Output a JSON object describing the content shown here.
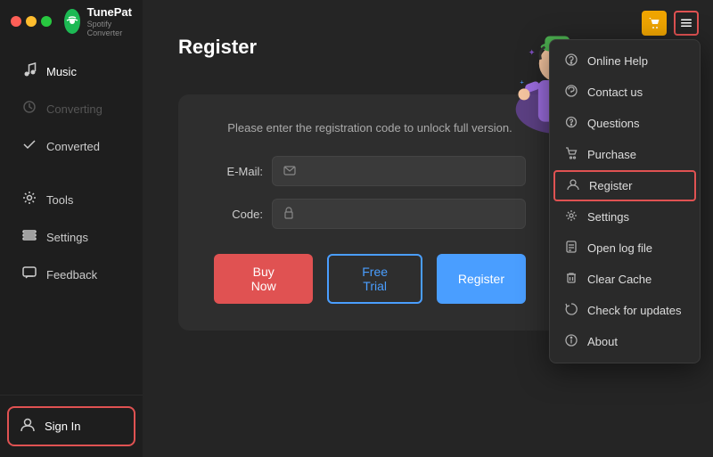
{
  "app": {
    "name": "TunePat",
    "subtitle": "Spotify Converter"
  },
  "traffic_lights": {
    "red": "close",
    "yellow": "minimize",
    "green": "maximize"
  },
  "sidebar": {
    "items": [
      {
        "id": "music",
        "label": "Music",
        "icon": "♪",
        "active": true,
        "disabled": false
      },
      {
        "id": "converting",
        "label": "Converting",
        "icon": "⟳",
        "active": false,
        "disabled": true
      },
      {
        "id": "converted",
        "label": "Converted",
        "icon": "✓",
        "active": false,
        "disabled": false
      }
    ],
    "tools_section": [
      {
        "id": "tools",
        "label": "Tools",
        "icon": "⚙"
      },
      {
        "id": "settings",
        "label": "Settings",
        "icon": "≡"
      },
      {
        "id": "feedback",
        "label": "Feedback",
        "icon": "✉"
      }
    ],
    "sign_in_label": "Sign In"
  },
  "topbar": {
    "cart_icon": "🛒",
    "menu_icon": "☰"
  },
  "register_page": {
    "title": "Register",
    "description": "Please enter the registration code to unlock full version.",
    "email_label": "E-Mail:",
    "email_placeholder": "",
    "code_label": "Code:",
    "code_placeholder": "",
    "btn_buy_now": "Buy Now",
    "btn_free_trial": "Free Trial",
    "btn_register": "Register"
  },
  "dropdown": {
    "items": [
      {
        "id": "online-help",
        "label": "Online Help",
        "icon": "❓"
      },
      {
        "id": "contact-us",
        "label": "Contact us",
        "icon": "💬"
      },
      {
        "id": "questions",
        "label": "Questions",
        "icon": "❔"
      },
      {
        "id": "purchase",
        "label": "Purchase",
        "icon": "🛒"
      },
      {
        "id": "register",
        "label": "Register",
        "icon": "👤",
        "active": true
      },
      {
        "id": "settings",
        "label": "Settings",
        "icon": "⚙"
      },
      {
        "id": "open-log-file",
        "label": "Open log file",
        "icon": "📄"
      },
      {
        "id": "clear-cache",
        "label": "Clear Cache",
        "icon": "🗑"
      },
      {
        "id": "check-for-updates",
        "label": "Check for updates",
        "icon": "↻"
      },
      {
        "id": "about",
        "label": "About",
        "icon": "ℹ"
      }
    ]
  },
  "colors": {
    "accent_red": "#e05252",
    "accent_blue": "#4a9eff",
    "accent_orange": "#f0a500",
    "sidebar_bg": "#1e1e1e",
    "main_bg": "#252525",
    "form_bg": "#2e2e2e"
  }
}
